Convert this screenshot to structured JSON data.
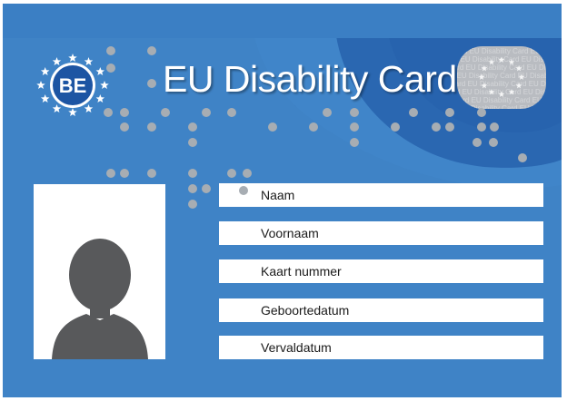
{
  "card": {
    "country_code": "BE",
    "title": "EU Disability Card",
    "hologram_text": "Card EU Disability Card EU Disability Card EU Disability Card EU",
    "fields": [
      {
        "label": "Naam"
      },
      {
        "label": "Voornaam"
      },
      {
        "label": "Kaart nummer"
      },
      {
        "label": "Geboortedatum"
      },
      {
        "label": "Vervaldatum"
      }
    ],
    "photo_icon": "person-silhouette-icon",
    "logo_icon": "eu-stars-icon"
  },
  "colors": {
    "card_blue": "#3f83c6",
    "dark_blue": "#1f5fa8",
    "logo_circle": "#1d55a3",
    "braille_dot": "#a7adb3",
    "star": "#ffffff"
  }
}
